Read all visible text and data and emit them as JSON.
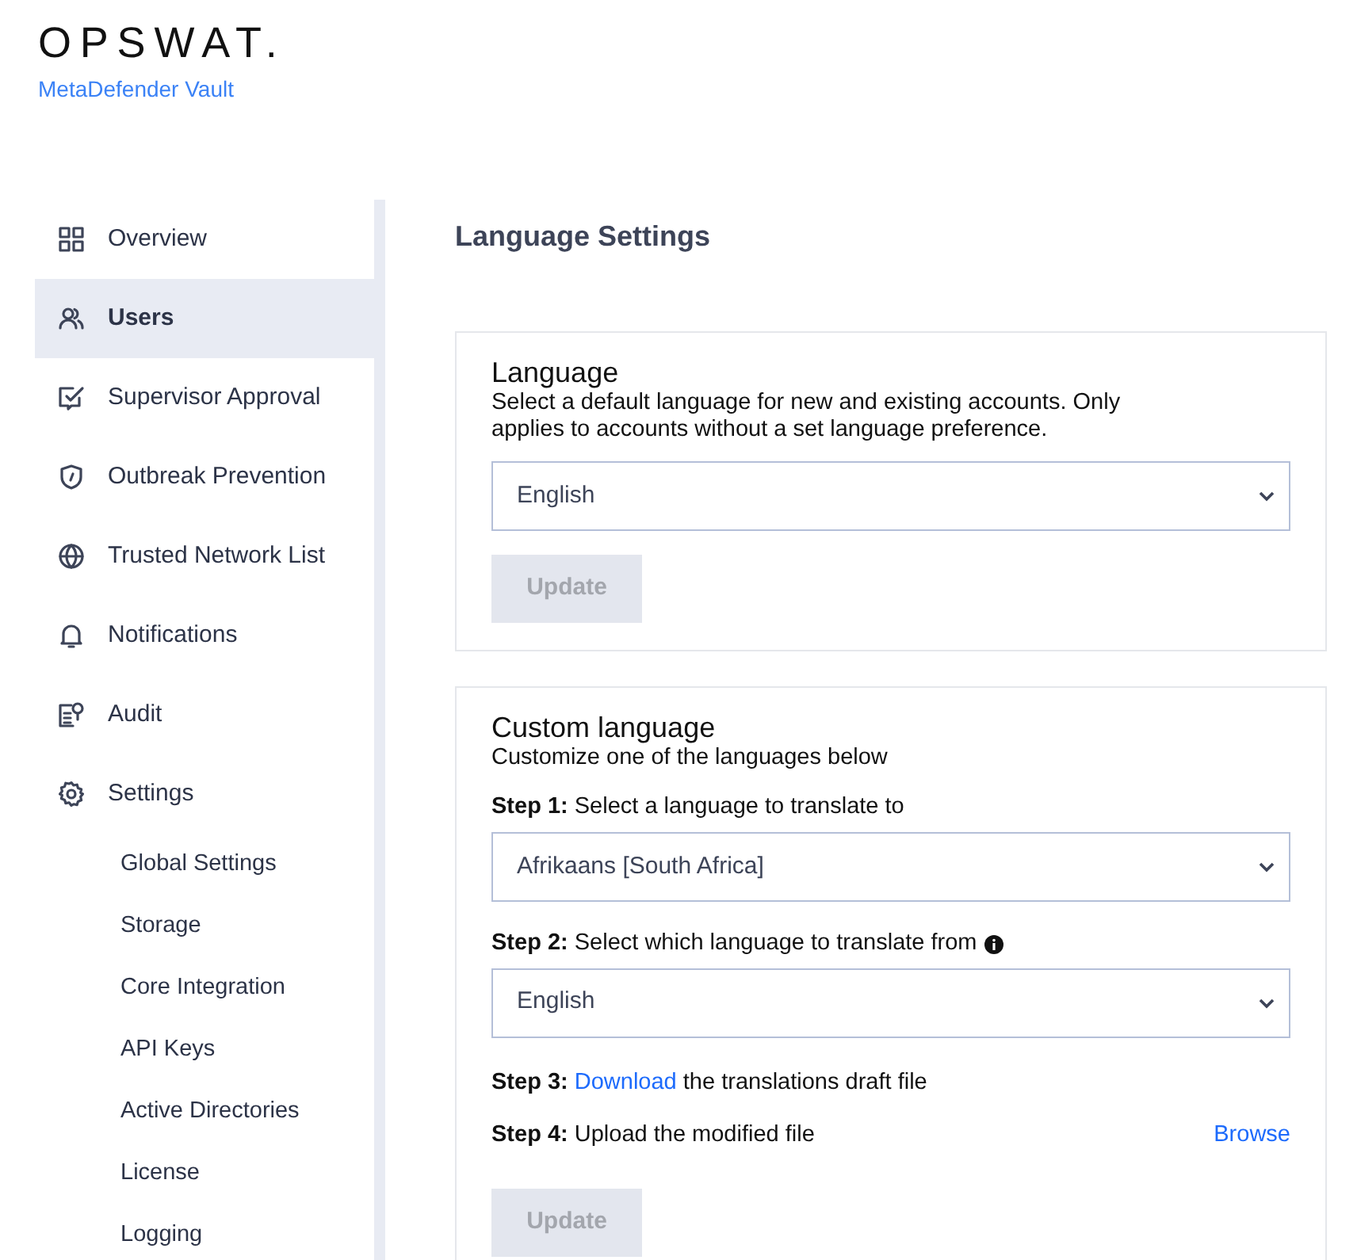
{
  "brand": {
    "logo": "OPSWAT.",
    "product": "MetaDefender Vault"
  },
  "sidebar": {
    "items": [
      {
        "label": "Overview",
        "selected": false
      },
      {
        "label": "Users",
        "selected": true
      },
      {
        "label": "Supervisor Approval",
        "selected": false
      },
      {
        "label": "Outbreak Prevention",
        "selected": false
      },
      {
        "label": "Trusted Network List",
        "selected": false
      },
      {
        "label": "Notifications",
        "selected": false
      },
      {
        "label": "Audit",
        "selected": false
      },
      {
        "label": "Settings",
        "selected": false,
        "children": [
          {
            "label": "Global Settings",
            "selected": false
          },
          {
            "label": "Storage",
            "selected": false
          },
          {
            "label": "Core Integration",
            "selected": false
          },
          {
            "label": "API Keys",
            "selected": false
          },
          {
            "label": "Active Directories",
            "selected": false
          },
          {
            "label": "License",
            "selected": false
          },
          {
            "label": "Logging",
            "selected": false
          }
        ]
      }
    ]
  },
  "page_title": "Language Settings",
  "language_card": {
    "title": "Language",
    "description": "Select a default language for new and existing accounts. Only applies to accounts without a set language preference.",
    "select": {
      "value": "English"
    },
    "button": {
      "label": "Update",
      "disabled": true
    }
  },
  "custom_card": {
    "title": "Custom language",
    "description": "Customize one of the languages below",
    "step1": {
      "label": "**Step 1:** Select a language to translate to",
      "select": {
        "value": "Afrikaans [South Africa]"
      }
    },
    "step2": {
      "label": "**Step 2:** Select which language to translate from",
      "select": {
        "value": "English"
      }
    },
    "step3": {
      "prefix": "Step 3:",
      "link": "Download",
      "suffix": "the translations draft file"
    },
    "step4": {
      "label": "**Step 4:** Upload the modified file",
      "link": "Browse"
    },
    "button": {
      "label": "Update",
      "disabled": true
    }
  }
}
